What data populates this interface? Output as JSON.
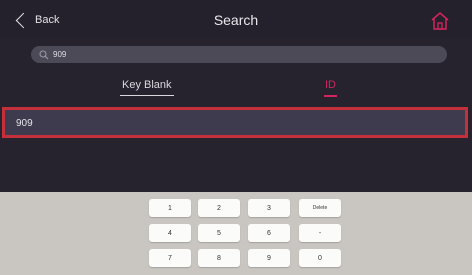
{
  "header": {
    "back_label": "Back",
    "title": "Search",
    "home_icon": "home-icon"
  },
  "search": {
    "value": "909",
    "icon": "search-icon"
  },
  "tabs": [
    {
      "label": "Key Blank",
      "active": false
    },
    {
      "label": "ID",
      "active": true
    }
  ],
  "results": [
    {
      "text": "909",
      "selected": true
    }
  ],
  "keypad": {
    "keys": [
      [
        "1",
        "2",
        "3",
        "Delete"
      ],
      [
        "4",
        "5",
        "6",
        "-"
      ],
      [
        "7",
        "8",
        "9",
        "0"
      ]
    ]
  },
  "colors": {
    "accent": "#d3255d",
    "selection_border": "#c3303c",
    "background": "#26232f",
    "keypad_bg": "#c9c5c1"
  }
}
